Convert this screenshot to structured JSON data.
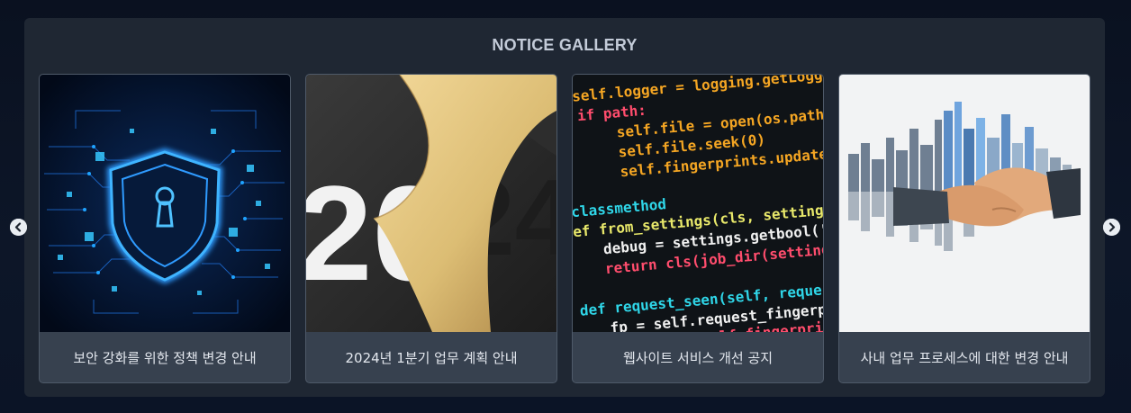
{
  "gallery": {
    "title": "NOTICE GALLERY",
    "prev_icon": "chevron-left-icon",
    "next_icon": "chevron-right-icon",
    "items": [
      {
        "caption": "보안 강화를 위한 정책 변경 안내",
        "image": "security-shield-image"
      },
      {
        "caption": "2024년 1분기 업무 계획 안내",
        "image": "year-2024-image"
      },
      {
        "caption": "웹사이트 서비스 개선 공지",
        "image": "code-editor-image"
      },
      {
        "caption": "사내 업무 프로세스에 대한 변경 안내",
        "image": "handshake-city-image"
      }
    ],
    "year_text": {
      "left": "20",
      "right": "24"
    },
    "code_lines": [
      "self.logger = logging.getLogger",
      "if path:",
      "self.file = open(os.path.join",
      "self.file.seek(0)",
      "self.fingerprints.update(",
      "classmethod",
      "ef from_settings(cls, settings",
      "debug = settings.getbool('DU",
      "return cls(job_dir(settings",
      "def request_seen(self, request",
      "fp = self.request_fingerpr",
      "if fp in self.fingerprints"
    ]
  },
  "colors": {
    "panel": "#1f2733",
    "caption_bg": "#37414f",
    "accent_blue": "#1e90ff",
    "gold": "#e2c47a"
  }
}
